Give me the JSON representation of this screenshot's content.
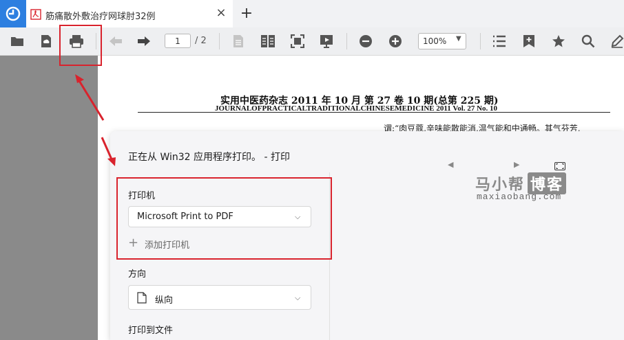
{
  "tab": {
    "title": "筋痛散外敷治疗网球肘32例",
    "close_glyph": "×",
    "new_tab_glyph": "+"
  },
  "toolbar": {
    "current_page": "1",
    "total_pages": "/ 2",
    "zoom": "100%",
    "icons": [
      "open-folder-icon",
      "cloud-save-icon",
      "printer-icon",
      "back-arrow-icon",
      "forward-arrow-icon",
      "page-icon",
      "two-page-icon",
      "fit-page-icon",
      "presentation-icon",
      "zoom-out-icon",
      "zoom-in-icon",
      "list-icon",
      "bookmark-add-icon",
      "star-icon",
      "search-icon",
      "pen-icon"
    ]
  },
  "document": {
    "header_zh": "实用中医药杂志  2011 年 10 月   第 27 卷 10 期(总第 225 期)",
    "header_en": "JOURNALOFPRACTICALTRADITIONALCHINESEMEDICINE   2011 Vol. 27 No. 10",
    "body_text": "谓:“肉豆蔻,辛味能散能消,温气能和中通畅。其气芬芳,"
  },
  "print_dialog": {
    "title": "正在从 Win32 应用程序打印。 - 打印",
    "printer_label": "打印机",
    "printer_value": "Microsoft Print to PDF",
    "add_printer": "添加打印机",
    "orientation_label": "方向",
    "orientation_value": "纵向",
    "print_to_file_label": "打印到文件"
  },
  "watermark": {
    "main_a": "马小帮",
    "main_b": "博客",
    "sub": "maxiaobang.com"
  },
  "colors": {
    "accent": "#2d7fe0",
    "annotation": "#d9232d",
    "sidebar": "#8a8a8a"
  }
}
